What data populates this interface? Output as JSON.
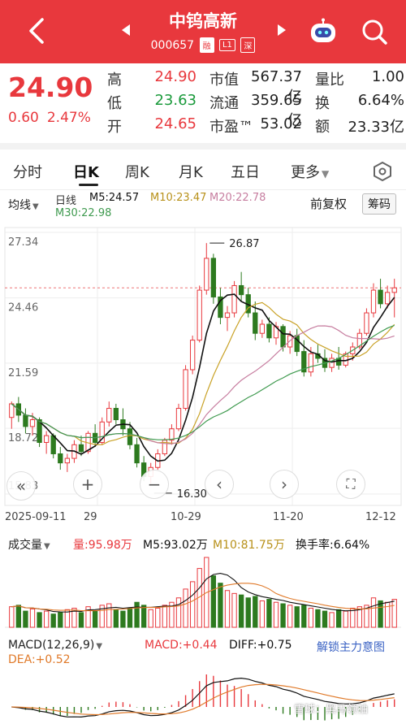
{
  "header": {
    "title": "中钨高新",
    "code": "000657",
    "tags": [
      "融",
      "L1",
      "深"
    ]
  },
  "quote": {
    "price": "24.90",
    "change": "0.60",
    "change_pct": "2.47%",
    "rows": [
      {
        "l1": "高",
        "v1": "24.90",
        "c1": "red",
        "l2": "市值",
        "v2": "567.37亿",
        "l3": "量比",
        "v3": "1.00"
      },
      {
        "l1": "低",
        "v1": "23.63",
        "c1": "green",
        "l2": "流通",
        "v2": "359.65亿",
        "l3": "换",
        "v3": "6.64%"
      },
      {
        "l1": "开",
        "v1": "24.65",
        "c1": "red",
        "l2": "市盈™",
        "v2": "53.02",
        "l3": "额",
        "v3": "23.33亿"
      }
    ]
  },
  "tabs": [
    "分时",
    "日K",
    "周K",
    "月K",
    "五日",
    "更多"
  ],
  "active_tab": "日K",
  "kline_header": {
    "indicator_select": "均线",
    "period": "日线",
    "ma5": "M5:24.57",
    "ma10": "M10:23.47",
    "ma20": "M20:22.78",
    "ma30": "M30:22.98",
    "adjust": "前复权",
    "chips": "筹码"
  },
  "colors": {
    "up": "#e8383d",
    "down": "#2d7a1f",
    "ma5": "#111111",
    "ma10": "#c9a227",
    "ma20": "#c77ea0",
    "ma30": "#3f9a4f"
  },
  "chart_data": {
    "type": "candlestick",
    "y_ticks": [
      "27.34",
      "24.46",
      "21.59",
      "18.72",
      "15.83"
    ],
    "ylim": [
      15.83,
      27.34
    ],
    "x_labels": [
      "2025-09-11",
      "29",
      "10-29",
      "11-20",
      "12-12"
    ],
    "max_label": "26.87",
    "min_label": "16.30",
    "candles": [
      [
        19.2,
        19.9,
        18.7,
        19.8
      ],
      [
        19.8,
        20.1,
        19.0,
        19.3
      ],
      [
        19.3,
        19.6,
        18.5,
        18.8
      ],
      [
        18.8,
        19.4,
        18.4,
        19.1
      ],
      [
        19.1,
        19.2,
        17.9,
        18.1
      ],
      [
        18.1,
        18.6,
        17.6,
        18.4
      ],
      [
        18.4,
        18.5,
        17.4,
        17.6
      ],
      [
        17.6,
        17.9,
        16.9,
        17.2
      ],
      [
        17.2,
        17.6,
        16.8,
        17.4
      ],
      [
        17.4,
        18.2,
        17.2,
        18.0
      ],
      [
        18.0,
        18.4,
        17.5,
        17.7
      ],
      [
        17.7,
        18.6,
        17.6,
        18.5
      ],
      [
        18.5,
        18.9,
        17.9,
        18.1
      ],
      [
        18.1,
        19.2,
        18.0,
        19.0
      ],
      [
        19.0,
        19.9,
        18.8,
        19.6
      ],
      [
        19.6,
        19.8,
        18.9,
        19.1
      ],
      [
        19.1,
        19.6,
        18.4,
        18.7
      ],
      [
        18.7,
        19.0,
        17.8,
        18.0
      ],
      [
        18.0,
        18.3,
        17.0,
        17.2
      ],
      [
        17.2,
        17.5,
        16.4,
        16.6
      ],
      [
        16.6,
        17.2,
        16.3,
        17.0
      ],
      [
        17.0,
        17.8,
        16.9,
        17.6
      ],
      [
        17.6,
        18.3,
        17.5,
        18.2
      ],
      [
        18.2,
        18.9,
        18.0,
        18.7
      ],
      [
        18.7,
        19.8,
        18.6,
        19.6
      ],
      [
        19.6,
        21.5,
        19.5,
        21.3
      ],
      [
        21.3,
        22.8,
        21.1,
        22.6
      ],
      [
        22.6,
        25.0,
        22.5,
        24.8
      ],
      [
        24.8,
        26.87,
        24.6,
        26.2
      ],
      [
        26.2,
        26.4,
        24.2,
        24.5
      ],
      [
        24.5,
        24.9,
        23.3,
        23.6
      ],
      [
        23.6,
        24.1,
        23.0,
        23.8
      ],
      [
        23.8,
        25.2,
        23.6,
        25.0
      ],
      [
        25.0,
        25.6,
        24.3,
        24.6
      ],
      [
        24.6,
        24.9,
        23.6,
        23.8
      ],
      [
        23.8,
        24.3,
        22.6,
        22.9
      ],
      [
        22.9,
        23.5,
        22.7,
        23.3
      ],
      [
        23.3,
        23.6,
        22.5,
        22.7
      ],
      [
        22.7,
        23.4,
        22.4,
        23.2
      ],
      [
        23.2,
        23.3,
        22.1,
        22.3
      ],
      [
        22.3,
        23.0,
        22.0,
        22.8
      ],
      [
        22.8,
        23.1,
        21.9,
        22.1
      ],
      [
        22.1,
        22.6,
        21.0,
        21.2
      ],
      [
        21.2,
        22.3,
        21.0,
        22.0
      ],
      [
        22.0,
        22.4,
        21.6,
        21.8
      ],
      [
        21.8,
        22.2,
        21.2,
        21.4
      ],
      [
        21.4,
        22.0,
        21.2,
        21.8
      ],
      [
        21.8,
        22.3,
        21.3,
        21.5
      ],
      [
        21.5,
        22.1,
        21.4,
        22.0
      ],
      [
        22.0,
        22.5,
        21.7,
        22.3
      ],
      [
        22.3,
        23.1,
        22.2,
        22.9
      ],
      [
        22.9,
        24.0,
        22.8,
        23.8
      ],
      [
        23.8,
        25.1,
        23.6,
        24.8
      ],
      [
        24.8,
        25.3,
        24.0,
        24.2
      ],
      [
        24.2,
        25.0,
        24.0,
        24.7
      ],
      [
        24.7,
        25.3,
        23.6,
        24.9
      ]
    ],
    "volume_label": "成交量",
    "volume": "量:95.98万",
    "vol_ma5": "M5:93.02万",
    "vol_ma10": "M10:81.75万",
    "turnover": "换手率:6.64%",
    "volumes": [
      28,
      30,
      22,
      25,
      20,
      22,
      18,
      20,
      24,
      26,
      20,
      28,
      22,
      30,
      32,
      24,
      22,
      26,
      34,
      30,
      24,
      26,
      30,
      34,
      40,
      52,
      62,
      80,
      95,
      70,
      60,
      50,
      46,
      44,
      40,
      42,
      36,
      38,
      34,
      32,
      30,
      28,
      30,
      26,
      24,
      22,
      20,
      24,
      22,
      26,
      28,
      30,
      40,
      36,
      34,
      38
    ],
    "macd_label": "MACD(12,26,9)",
    "macd": "MACD:+0.44",
    "diff": "DIFF:+0.75",
    "dea": "DEA:+0.52",
    "unlock": "解锁主力意图"
  },
  "watermark": "雪球：黑马领袖"
}
